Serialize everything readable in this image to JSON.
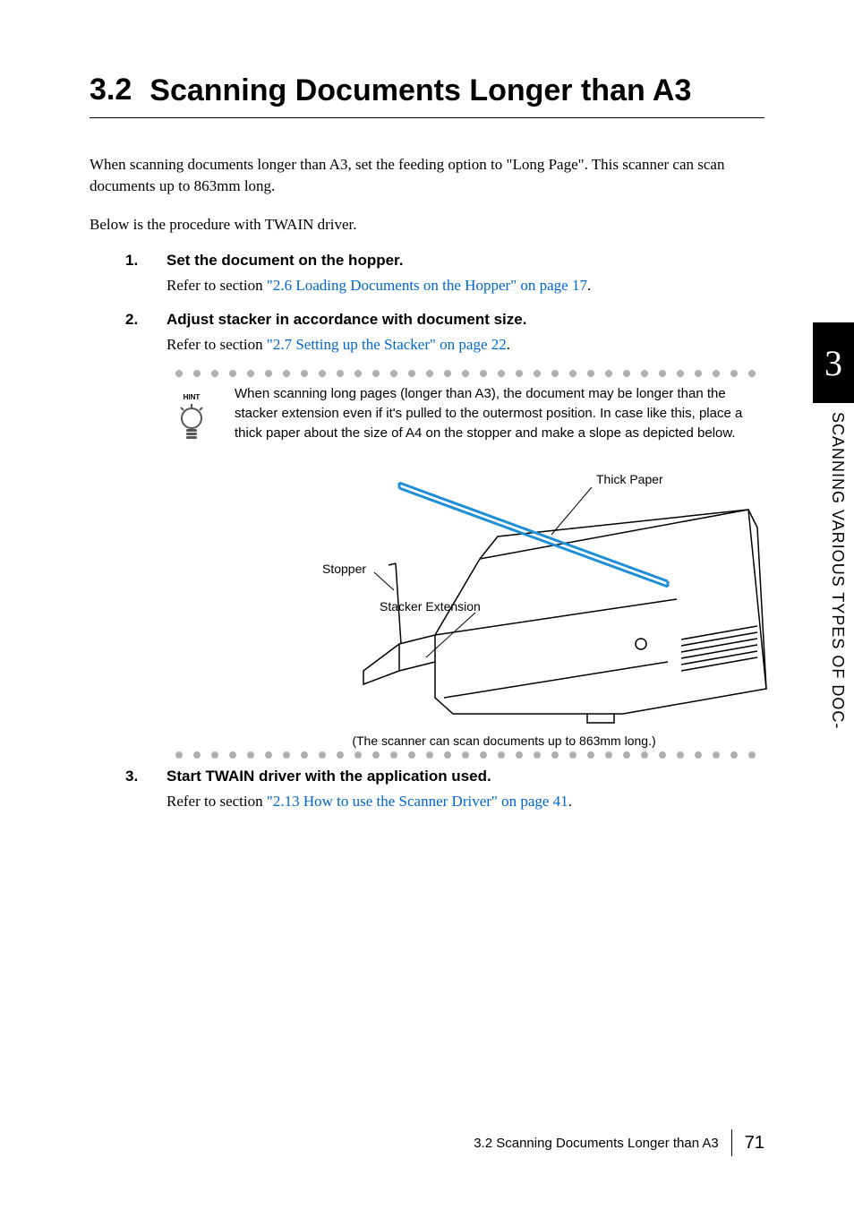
{
  "section": {
    "number": "3.2",
    "title": "Scanning Documents Longer than A3"
  },
  "intro": {
    "p1": "When scanning documents longer than A3, set the feeding option to \"Long Page\". This scanner can scan documents up to 863mm long.",
    "p2": "Below is the procedure with TWAIN driver."
  },
  "steps": [
    {
      "num": "1.",
      "title": "Set the document on the hopper.",
      "prefix": "Refer to section ",
      "link": "\"2.6 Loading Documents on the Hopper\" on page 17",
      "suffix": "."
    },
    {
      "num": "2.",
      "title": "Adjust stacker in accordance with document size.",
      "prefix": "Refer to section ",
      "link": "\"2.7 Setting up the Stacker\" on page 22",
      "suffix": "."
    },
    {
      "num": "3.",
      "title": "Start TWAIN driver with the application used.",
      "prefix": "Refer to section ",
      "link": "\"2.13 How to use the Scanner Driver\" on page 41",
      "suffix": "."
    }
  ],
  "hint": {
    "label": "HINT",
    "text": "When scanning long pages (longer than A3), the document may be longer than the stacker extension even if it's pulled to the outermost position. In case like this, place a thick paper about the size of A4 on the stopper and make a slope as depicted below."
  },
  "diagram": {
    "label_thick_paper": "Thick Paper",
    "label_stopper": "Stopper",
    "label_stacker_ext": "Stacker Extension",
    "caption": "(The scanner can scan documents up to 863mm long.)"
  },
  "sidebar": {
    "chapter_num": "3",
    "chapter_title": "SCANNING VARIOUS TYPES OF DOC-"
  },
  "footer": {
    "text": "3.2 Scanning Documents Longer than A3",
    "page": "71"
  }
}
